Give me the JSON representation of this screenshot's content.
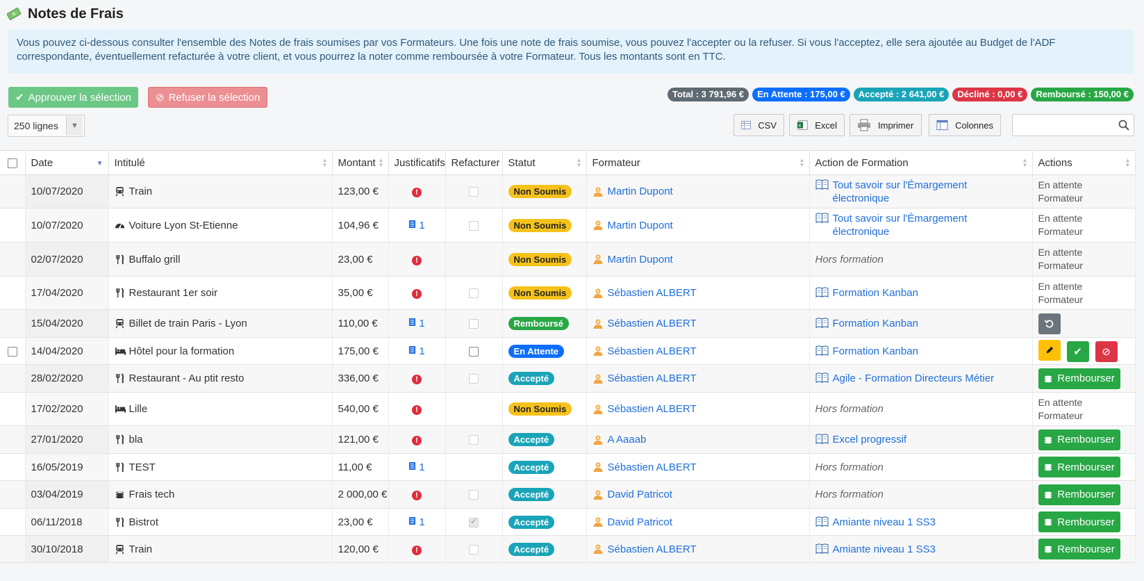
{
  "header": {
    "title": "Notes de Frais",
    "icon": "money-icon"
  },
  "info": "Vous pouvez ci-dessous consulter l'ensemble des Notes de frais soumises par vos Formateurs. Une fois une note de frais soumise, vous pouvez l'accepter ou la refuser. Si vous l'acceptez, elle sera ajoutée au Budget de l'ADF correspondante, éventuellement refacturée à votre client, et vous pourrez la noter comme remboursée à votre Formateur. Tous les montants sont en TTC.",
  "actions": {
    "approve": "Approuver la sélection",
    "refuse": "Refuser la sélection"
  },
  "summary": [
    {
      "label": "Total : 3 791,96 €",
      "color": "#5f6a72"
    },
    {
      "label": "En Attente : 175,00 €",
      "color": "#0d6efd"
    },
    {
      "label": "Accepté : 2 641,00 €",
      "color": "#1aa4b8"
    },
    {
      "label": "Décliné : 0,00 €",
      "color": "#dc3545"
    },
    {
      "label": "Remboursé : 150,00 €",
      "color": "#28a745"
    }
  ],
  "lines": "250 lignes",
  "tools": {
    "csv": "CSV",
    "excel": "Excel",
    "print": "Imprimer",
    "columns": "Colonnes"
  },
  "search": {
    "placeholder": ""
  },
  "columns": {
    "date": "Date",
    "intitule": "Intitulé",
    "montant": "Montant",
    "justificatifs": "Justificatifs",
    "refacturer": "Refacturer",
    "statut": "Statut",
    "formateur": "Formateur",
    "action": "Action de Formation",
    "actions": "Actions"
  },
  "labels": {
    "pending": "En attente Formateur",
    "hors": "Hors formation",
    "rembourser": "Rembourser",
    "status": {
      "ns": "Non Soumis",
      "ok": "Accepté",
      "rb": "Remboursé",
      "wait": "En Attente"
    }
  },
  "rows": [
    {
      "date": "10/07/2020",
      "icon": "train",
      "intitule": "Train",
      "montant": "123,00 €",
      "just": "error",
      "refact": "dim",
      "status": "ns",
      "formateur": "Martin Dupont",
      "formation": "Tout savoir sur l'Émargement électronique",
      "action": "pending",
      "select": false
    },
    {
      "date": "10/07/2020",
      "icon": "gauge",
      "intitule": "Voiture Lyon St-Etienne",
      "montant": "104,96 €",
      "just": "1",
      "refact": "dim",
      "status": "ns",
      "formateur": "Martin Dupont",
      "formation": "Tout savoir sur l'Émargement électronique",
      "action": "pending",
      "select": false
    },
    {
      "date": "02/07/2020",
      "icon": "fork",
      "intitule": "Buffalo grill",
      "montant": "23,00 €",
      "just": "error",
      "refact": "none",
      "status": "ns",
      "formateur": "Martin Dupont",
      "formation": "",
      "action": "pending",
      "select": false
    },
    {
      "date": "17/04/2020",
      "icon": "fork",
      "intitule": "Restaurant 1er soir",
      "montant": "35,00 €",
      "just": "error",
      "refact": "dim",
      "status": "ns",
      "formateur": "Sébastien ALBERT",
      "formation": "Formation Kanban",
      "action": "pending",
      "select": false
    },
    {
      "date": "15/04/2020",
      "icon": "train",
      "intitule": "Billet de train Paris - Lyon",
      "montant": "110,00 €",
      "just": "1",
      "refact": "dim",
      "status": "rb",
      "formateur": "Sébastien ALBERT",
      "formation": "Formation Kanban",
      "action": "undo",
      "select": false
    },
    {
      "date": "14/04/2020",
      "icon": "bed",
      "intitule": "Hôtel pour la formation",
      "montant": "175,00 €",
      "just": "1",
      "refact": "active",
      "status": "wait",
      "formateur": "Sébastien ALBERT",
      "formation": "Formation Kanban",
      "action": "decide",
      "select": true
    },
    {
      "date": "28/02/2020",
      "icon": "fork",
      "intitule": "Restaurant - Au ptit resto",
      "montant": "336,00 €",
      "just": "error",
      "refact": "dim",
      "status": "ok",
      "formateur": "Sébastien ALBERT",
      "formation": "Agile - Formation Directeurs Métier",
      "action": "rembourser",
      "select": false
    },
    {
      "date": "17/02/2020",
      "icon": "bed",
      "intitule": "Lille",
      "montant": "540,00 €",
      "just": "error",
      "refact": "none",
      "status": "ns",
      "formateur": "Sébastien ALBERT",
      "formation": "",
      "action": "pending",
      "select": false
    },
    {
      "date": "27/01/2020",
      "icon": "fork",
      "intitule": "bla",
      "montant": "121,00 €",
      "just": "error",
      "refact": "dim",
      "status": "ok",
      "formateur": "A Aaaab",
      "formation": "Excel progressif",
      "action": "rembourser",
      "select": false
    },
    {
      "date": "16/05/2019",
      "icon": "fork",
      "intitule": "TEST",
      "montant": "11,00 €",
      "just": "1",
      "refact": "none",
      "status": "ok",
      "formateur": "Sébastien ALBERT",
      "formation": "",
      "action": "rembourser",
      "select": false
    },
    {
      "date": "03/04/2019",
      "icon": "coins",
      "intitule": "Frais tech",
      "montant": "2 000,00 €",
      "just": "error",
      "refact": "dim",
      "status": "ok",
      "formateur": "David Patricot",
      "formation": "",
      "action": "rembourser",
      "select": false
    },
    {
      "date": "06/11/2018",
      "icon": "fork",
      "intitule": "Bistrot",
      "montant": "23,00 €",
      "just": "1",
      "refact": "checked",
      "status": "ok",
      "formateur": "David Patricot",
      "formation": "Amiante niveau 1 SS3",
      "action": "rembourser",
      "select": false
    },
    {
      "date": "30/10/2018",
      "icon": "train",
      "intitule": "Train",
      "montant": "120,00 €",
      "just": "error",
      "refact": "dim",
      "status": "ok",
      "formateur": "Sébastien ALBERT",
      "formation": "Amiante niveau 1 SS3",
      "action": "rembourser",
      "select": false
    }
  ]
}
